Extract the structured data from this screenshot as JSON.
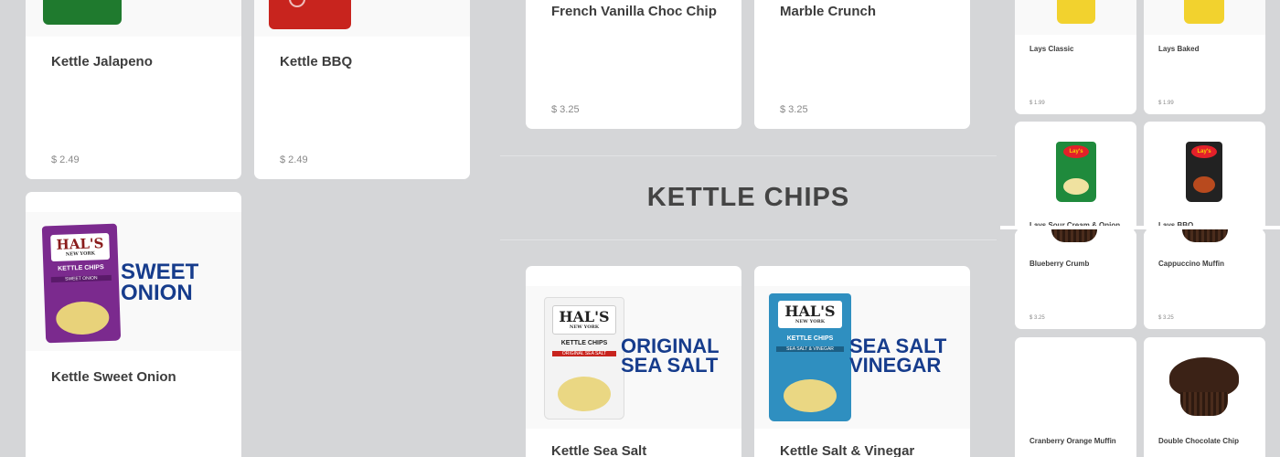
{
  "panel1": {
    "cards": [
      {
        "name": "Kettle Jalapeno",
        "price": "$ 2.49",
        "bag_color": "#1f7a2e"
      },
      {
        "name": "Kettle BBQ",
        "price": "$ 2.49",
        "bag_color": "#c8241e"
      },
      {
        "name": "Kettle Sweet Onion",
        "price": "",
        "bag_color": "#7b2a8e",
        "brand": "HAL'S",
        "brand_sub": "NEW YORK",
        "brand_line": "KETTLE CHIPS",
        "bag_flavor": "SWEET ONION",
        "flavor_line1": "SWEET",
        "flavor_line2": "ONION"
      }
    ]
  },
  "panel2": {
    "top_cards": [
      {
        "name": "French Vanilla Choc Chip",
        "price": "$ 3.25"
      },
      {
        "name": "Marble Crunch",
        "price": "$ 3.25"
      }
    ],
    "section_title": "KETTLE CHIPS",
    "cards": [
      {
        "name": "Kettle Sea Salt",
        "bag_color": "#c8241e",
        "brand": "HAL'S",
        "brand_sub": "NEW YORK",
        "brand_line": "KETTLE CHIPS",
        "bag_flavor": "ORIGINAL SEA SALT",
        "flavor_line1": "ORIGINAL",
        "flavor_line2": "SEA SALT"
      },
      {
        "name": "Kettle Salt & Vinegar",
        "bag_color": "#2f8fc0",
        "brand": "HAL'S",
        "brand_sub": "NEW YORK",
        "brand_line": "KETTLE CHIPS",
        "bag_flavor": "SEA SALT & VINEGAR",
        "flavor_line1": "SEA SALT",
        "flavor_line2": "VINEGAR"
      }
    ]
  },
  "panel3": {
    "row1": [
      {
        "name": "Lays Classic",
        "price": "$ 1.99",
        "bag_color": "#f2d22e"
      },
      {
        "name": "Lays Baked",
        "price": "$ 1.99",
        "bag_color": "#f2d22e"
      }
    ],
    "row2": [
      {
        "name": "Lays Sour Cream & Onion",
        "bag_color": "#1f8a3c",
        "logo": "Lay's"
      },
      {
        "name": "Lays BBQ",
        "bag_color": "#222222",
        "logo": "Lay's"
      }
    ],
    "row3": [
      {
        "name": "Blueberry Crumb",
        "price": "$ 3.25"
      },
      {
        "name": "Cappuccino Muffin",
        "price": "$ 3.25"
      }
    ],
    "row4": [
      {
        "name": "Cranberry Orange Muffin"
      },
      {
        "name": "Double Chocolate Chip"
      }
    ]
  }
}
